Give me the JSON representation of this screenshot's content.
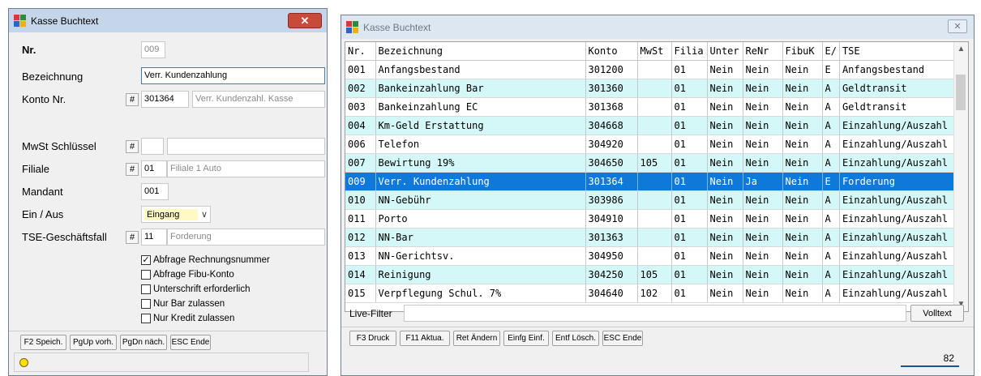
{
  "left_window": {
    "title": "Kasse Buchtext",
    "close_glyph": "✕",
    "fields": {
      "nr_label": "Nr.",
      "nr_value": "009",
      "bezeichnung_label": "Bezeichnung",
      "bezeichnung_value": "Verr. Kundenzahlung",
      "konto_label": "Konto Nr.",
      "konto_hash": "#",
      "konto_value": "301364",
      "konto_desc": "Verr. Kundenzahl. Kasse",
      "mwst_label": "MwSt Schlüssel",
      "mwst_hash": "#",
      "mwst_value": "",
      "mwst_desc": "",
      "filiale_label": "Filiale",
      "filiale_hash": "#",
      "filiale_value": "01",
      "filiale_desc": "Filiale 1 Auto",
      "mandant_label": "Mandant",
      "mandant_value": "001",
      "einaus_label": "Ein / Aus",
      "einaus_value": "Eingang",
      "tse_label": "TSE-Geschäftsfall",
      "tse_hash": "#",
      "tse_value": "11",
      "tse_desc": "Forderung"
    },
    "checkboxes": [
      {
        "label": "Abfrage Rechnungsnummer",
        "checked": true
      },
      {
        "label": "Abfrage Fibu-Konto",
        "checked": false
      },
      {
        "label": "Unterschrift erforderlich",
        "checked": false
      },
      {
        "label": "Nur Bar zulassen",
        "checked": false
      },
      {
        "label": "Nur Kredit zulassen",
        "checked": false
      }
    ],
    "buttons": [
      "F2 Speich.",
      "PgUp vorh.",
      "PgDn näch.",
      "ESC Ende"
    ],
    "status_color": "#ffe000"
  },
  "right_window": {
    "title": "Kasse Buchtext",
    "close_glyph": "✕",
    "columns": [
      "Nr.",
      "Bezeichnung",
      "Konto",
      "MwSt",
      "Filia",
      "Unter",
      "ReNr",
      "FibuK",
      "E/",
      "TSE"
    ],
    "rows": [
      [
        "001",
        "Anfangsbestand",
        "301200",
        "",
        "01",
        "Nein",
        "Nein",
        "Nein",
        "E",
        "Anfangsbestand"
      ],
      [
        "002",
        "Bankeinzahlung Bar",
        "301360",
        "",
        "01",
        "Nein",
        "Nein",
        "Nein",
        "A",
        "Geldtransit"
      ],
      [
        "003",
        "Bankeinzahlung EC",
        "301368",
        "",
        "01",
        "Nein",
        "Nein",
        "Nein",
        "A",
        "Geldtransit"
      ],
      [
        "004",
        "Km-Geld Erstattung",
        "304668",
        "",
        "01",
        "Nein",
        "Nein",
        "Nein",
        "A",
        "Einzahlung/Auszahl"
      ],
      [
        "006",
        "Telefon",
        "304920",
        "",
        "01",
        "Nein",
        "Nein",
        "Nein",
        "A",
        "Einzahlung/Auszahl"
      ],
      [
        "007",
        "Bewirtung 19%",
        "304650",
        "105",
        "01",
        "Nein",
        "Nein",
        "Nein",
        "A",
        "Einzahlung/Auszahl"
      ],
      [
        "009",
        "Verr. Kundenzahlung",
        "301364",
        "",
        "01",
        "Nein",
        "Ja",
        "Nein",
        "E",
        "Forderung"
      ],
      [
        "010",
        "NN-Gebühr",
        "303986",
        "",
        "01",
        "Nein",
        "Nein",
        "Nein",
        "A",
        "Einzahlung/Auszahl"
      ],
      [
        "011",
        "Porto",
        "304910",
        "",
        "01",
        "Nein",
        "Nein",
        "Nein",
        "A",
        "Einzahlung/Auszahl"
      ],
      [
        "012",
        "NN-Bar",
        "301363",
        "",
        "01",
        "Nein",
        "Nein",
        "Nein",
        "A",
        "Einzahlung/Auszahl"
      ],
      [
        "013",
        "NN-Gerichtsv.",
        "304950",
        "",
        "01",
        "Nein",
        "Nein",
        "Nein",
        "A",
        "Einzahlung/Auszahl"
      ],
      [
        "014",
        "Reinigung",
        "304250",
        "105",
        "01",
        "Nein",
        "Nein",
        "Nein",
        "A",
        "Einzahlung/Auszahl"
      ],
      [
        "015",
        "Verpflegung Schul. 7%",
        "304640",
        "102",
        "01",
        "Nein",
        "Nein",
        "Nein",
        "A",
        "Einzahlung/Auszahl"
      ]
    ],
    "selected_row": 6,
    "live_filter_label": "Live-Filter",
    "live_filter_value": "",
    "volltext_label": "Volltext",
    "buttons": [
      "F3 Druck",
      "F11 Aktua.",
      "Ret Ändern",
      "Einfg Einf.",
      "Entf Lösch.",
      "ESC Ende"
    ],
    "count": "82",
    "colors": {
      "row_alt": "#d4f7f7",
      "row_selected": "#0f79d9"
    }
  }
}
